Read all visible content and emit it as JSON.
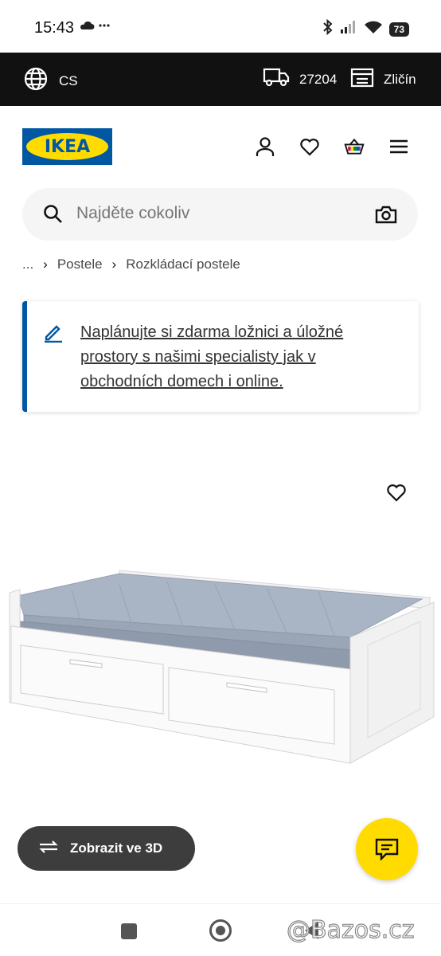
{
  "status_bar": {
    "time": "15:43",
    "battery": "73"
  },
  "top_bar": {
    "language": "CS",
    "postcode": "27204",
    "store": "Zličín"
  },
  "logo_text": "IKEA",
  "search": {
    "placeholder": "Najděte cokoliv"
  },
  "breadcrumb": {
    "ellipsis": "...",
    "items": [
      "Postele",
      "Rozkládací postele"
    ]
  },
  "banner": {
    "text": "Naplánujte si zdarma ložnici a úložné prostory s našimi specialisty jak v obchodních domech i online."
  },
  "view_3d": {
    "label": "Zobrazit ve 3D"
  },
  "watermark": "@Bazos.cz",
  "colors": {
    "ikea_blue": "#0058a3",
    "ikea_yellow": "#ffdb00",
    "top_bar": "#111111",
    "button_dark": "#3d3d3d"
  }
}
